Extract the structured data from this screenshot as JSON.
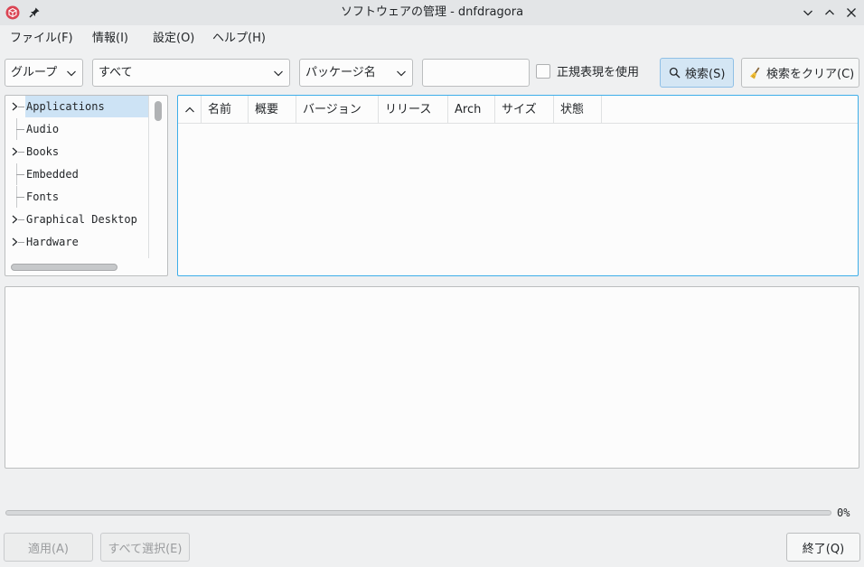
{
  "window": {
    "title": "ソフトウェアの管理 - dnfdragora",
    "icons": {
      "app": "dnfdragora-cube-icon",
      "pin": "pin-icon",
      "minimize": "chevron-down-icon",
      "maximize": "chevron-up-icon",
      "close": "close-icon"
    }
  },
  "menu": {
    "file": "ファイル(F)",
    "info": "情報(I)",
    "settings": "設定(O)",
    "help": "ヘルプ(H)"
  },
  "toolbar": {
    "group_combo": "グループ",
    "filter_combo": "すべて",
    "search_field_combo": "パッケージ名",
    "search_value": "",
    "regex_label": "正規表現を使用",
    "regex_checked": false,
    "search_button": "検索(S)",
    "clear_button": "検索をクリア(C)"
  },
  "groups": [
    {
      "label": "Applications",
      "expandable": true,
      "selected": true
    },
    {
      "label": "Audio",
      "expandable": false,
      "selected": false
    },
    {
      "label": "Books",
      "expandable": true,
      "selected": false
    },
    {
      "label": "Embedded",
      "expandable": false,
      "selected": false
    },
    {
      "label": "Fonts",
      "expandable": false,
      "selected": false
    },
    {
      "label": "Graphical Desktop",
      "expandable": true,
      "selected": false
    },
    {
      "label": "Hardware",
      "expandable": true,
      "selected": false
    }
  ],
  "table": {
    "columns": [
      "名前",
      "概要",
      "バージョン",
      "リリース",
      "Arch",
      "サイズ",
      "状態"
    ],
    "rows": []
  },
  "progress": {
    "value": 0,
    "label": "0%"
  },
  "buttons": {
    "apply": "適用(A)",
    "select_all": "すべて選択(E)",
    "quit": "終了(Q)"
  },
  "colors": {
    "accent": "#3daee9",
    "selection": "#cde3f5",
    "app_icon": "#da4453"
  }
}
